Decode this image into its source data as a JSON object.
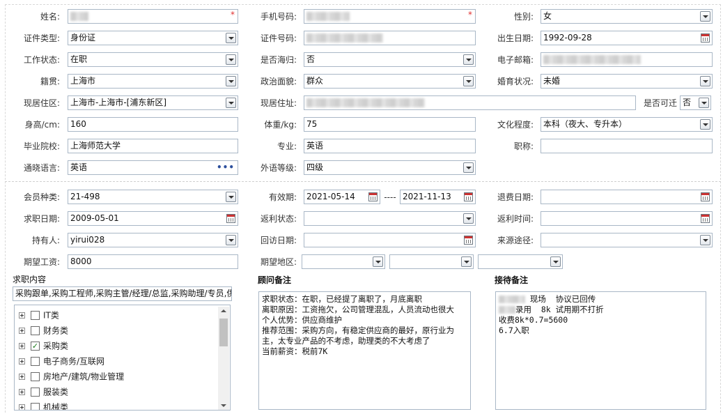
{
  "form": {
    "name_label": "姓名:",
    "mobile_label": "手机号码:",
    "gender_label": "性别:",
    "gender_value": "女",
    "idtype_label": "证件类型:",
    "idtype_value": "身份证",
    "idno_label": "证件号码:",
    "birth_label": "出生日期:",
    "birth_value": "1992-09-28",
    "workstatus_label": "工作状态:",
    "workstatus_value": "在职",
    "returnee_label": "是否海归:",
    "returnee_value": "否",
    "email_label": "电子邮箱:",
    "native_label": "籍贯:",
    "native_value": "上海市",
    "political_label": "政治面貌:",
    "political_value": "群众",
    "marital_label": "婚育状况:",
    "marital_value": "未婚",
    "district_label": "现居住区:",
    "district_value": "上海市-上海市-[浦东新区]",
    "address_label": "现居住址:",
    "relocate_label": "是否可迁",
    "relocate_value": "否",
    "height_label": "身高/cm:",
    "height_value": "160",
    "weight_label": "体重/kg:",
    "weight_value": "75",
    "education_label": "文化程度:",
    "education_value": "本科（夜大、专升本）",
    "school_label": "毕业院校:",
    "school_value": "上海师范大学",
    "major_label": "专业:",
    "major_value": "英语",
    "title_label": "职称:",
    "language_label": "通晓语言:",
    "language_value": "英语",
    "language_more": "•••",
    "level_label": "外语等级:",
    "level_value": "四级",
    "membertype_label": "会员种类:",
    "membertype_value": "21-498",
    "validity_label": "有效期:",
    "validity_start": "2021-05-14",
    "validity_sep": "----",
    "validity_end": "2021-11-13",
    "refund_label": "退费日期:",
    "jobdate_label": "求职日期:",
    "jobdate_value": "2009-05-01",
    "rebate_status_label": "返利状态:",
    "rebate_time_label": "返利时间:",
    "holder_label": "持有人:",
    "holder_value": "yirui028",
    "revisit_label": "回访日期:",
    "source_label": "来源途径:",
    "salary_label": "期望工资:",
    "salary_value": "8000",
    "area_label": "期望地区:"
  },
  "job": {
    "title": "求职内容",
    "summary": "采购跟单,采购工程师,采购主管/经理/总监,采购助理/专员,供",
    "tree": [
      {
        "label": "IT类",
        "checked": false
      },
      {
        "label": "财务类",
        "checked": false
      },
      {
        "label": "采购类",
        "checked": true
      },
      {
        "label": "电子商务/互联网",
        "checked": false
      },
      {
        "label": "房地产/建筑/物业管理",
        "checked": false
      },
      {
        "label": "服装类",
        "checked": false
      },
      {
        "label": "机械类",
        "checked": false
      }
    ]
  },
  "consultant": {
    "title": "顾问备注",
    "text": "求职状态：在职，已经提了离职了，月底离职\n离职原因：工资拖欠，公司管理混乱，人员流动也很大\n个人优势：供应商维护\n推荐范围：采购方向，有稳定供应商的最好，原行业为\n主，太专业产品的不考虑，助理类的不大考虑了\n当前薪资：税前7K"
  },
  "reception": {
    "title": "接待备注",
    "line1": " 现场  协议已回传",
    "line2": "录用  8k 试用期不打折",
    "line3": "收费8k*0.7=5600",
    "line4": "6.7入职"
  },
  "icons": {
    "dropdown": "chevron-down-icon",
    "calendar": "calendar-icon",
    "required": "asterisk-icon",
    "expand": "plus-square-icon",
    "checkbox": "checkbox-icon"
  },
  "colors": {
    "border": "#a9b7c6",
    "required": "#e03030",
    "checked": "#1a7a1a"
  }
}
